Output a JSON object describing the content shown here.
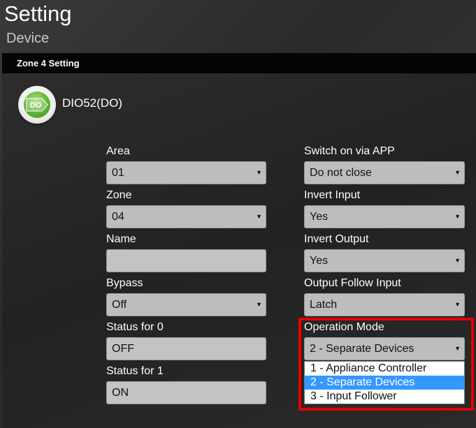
{
  "header": {
    "title": "Setting",
    "subtitle": "Device"
  },
  "panel": {
    "title": "Zone 4 Setting",
    "device_icon_text": "DO",
    "device_name": "DIO52(DO)"
  },
  "form": {
    "area": {
      "label": "Area",
      "value": "01"
    },
    "zone": {
      "label": "Zone",
      "value": "04"
    },
    "name": {
      "label": "Name",
      "value": ""
    },
    "bypass": {
      "label": "Bypass",
      "value": "Off"
    },
    "status0": {
      "label": "Status for 0",
      "value": "OFF"
    },
    "status1": {
      "label": "Status for 1",
      "value": "ON"
    },
    "switch_on_app": {
      "label": "Switch on via APP",
      "value": "Do not close"
    },
    "invert_input": {
      "label": "Invert Input",
      "value": "Yes"
    },
    "invert_output": {
      "label": "Invert Output",
      "value": "Yes"
    },
    "output_follow_input": {
      "label": "Output Follow Input",
      "value": "Latch"
    },
    "operation_mode": {
      "label": "Operation Mode",
      "value": "2 - Separate Devices",
      "options": [
        "1 - Appliance Controller",
        "2 - Separate Devices",
        "3 - Input Follower"
      ],
      "selected_index": 1
    }
  },
  "colors": {
    "highlight": "#e60000",
    "option_selected": "#3399ff",
    "icon_green": "#5fb33a"
  },
  "icons": {
    "select_arrow": "▼",
    "device": "do-output-icon"
  }
}
